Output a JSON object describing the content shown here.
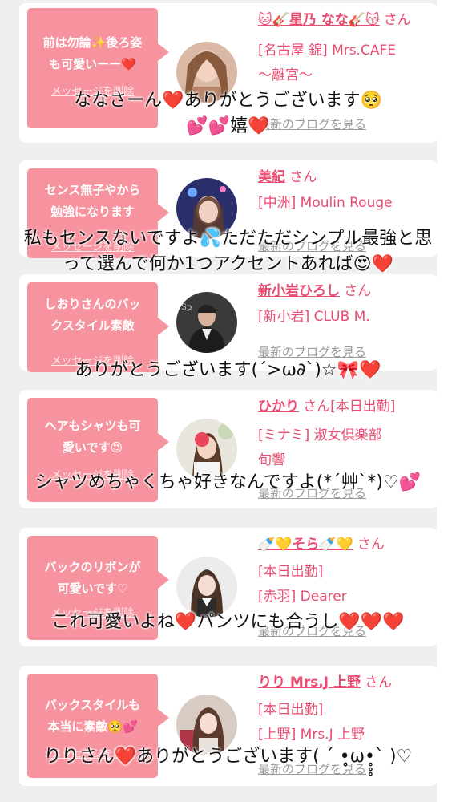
{
  "colors": {
    "bubble": "#f7939e",
    "accent": "#e94c70",
    "muted": "#999999"
  },
  "cards": [
    {
      "message": "前は勿論✨後ろ姿\nも可愛いーー❤️",
      "delete": "メッセージを削除",
      "name": "🐱🎸星乃 なな🎸😽",
      "san": "さん",
      "lines": [
        "[名古屋 錦] Mrs.CAFE",
        "〜離宮〜"
      ],
      "blog": "最新のブログを見る"
    },
    {
      "message": "センス無子やから\n勉強になります",
      "delete": "メッセージを削除",
      "name": "美紀",
      "san": "さん",
      "lines": [
        "[中洲] Moulin Rouge"
      ],
      "blog": "最新のブログを見る"
    },
    {
      "message": "しおりさんのバッ\nクスタイル素敵",
      "delete": "メッセージを削除",
      "name": "新小岩ひろし",
      "san": "さん",
      "lines": [
        "[新小岩] CLUB M."
      ],
      "blog": "最新のブログを見る"
    },
    {
      "message": "ヘアもシャツも可\n愛いです😍",
      "delete": "メッセージを削除",
      "name": "ひかり",
      "san": "さん[本日出勤]",
      "lines": [
        "[ミナミ] 淑女倶楽部",
        "旬響"
      ],
      "blog": "最新のブログを見る"
    },
    {
      "message": "バックのリボンが\n可愛いです♡",
      "delete": "メッセージを削除",
      "name": "🍼💛そら🍼💛",
      "san": "さん",
      "lines": [
        "[本日出勤]",
        "[赤羽] Dearer"
      ],
      "blog": "最新のブログを見る"
    },
    {
      "message": "バックスタイルも\n本当に素敵🥺💕",
      "delete": "メッセージを削除",
      "name": "りり Mrs.J 上野",
      "san": "さん",
      "lines": [
        "[本日出勤]",
        "[上野] Mrs.J 上野"
      ],
      "blog": "最新のブログを見る"
    }
  ],
  "overlays": [
    "ななさーん❤️ありがとうございます🥺\n💕💕嬉❤️",
    "私もセンスないですよ💦ただただシンプル最強と思\nって選んで何か1つアクセントあれば😍❤️",
    "ありがとうございます(´>ω∂`)☆🎀❤️",
    "シャツめちゃくちゃ好きなんですよ(*´艸`*)♡💕",
    "これ可愛いよね❤️パンツにも合うし❤️❤️❤️",
    "りりさん❤️ありがとうございます( ´ •̥̥̥ω•̥̥̥` )♡"
  ]
}
